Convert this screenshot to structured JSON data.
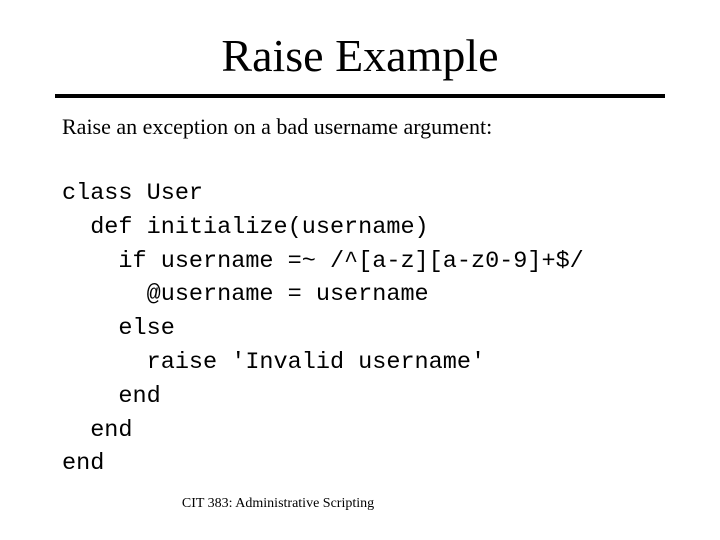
{
  "slide": {
    "title": "Raise Example",
    "intro": "Raise an exception on a bad username argument:",
    "code_lines": [
      "class User",
      "  def initialize(username)",
      "    if username =~ /^[a-z][a-z0-9]+$/",
      "      @username = username",
      "    else",
      "      raise 'Invalid username'",
      "    end",
      "  end",
      "end"
    ],
    "footer": "CIT 383: Administrative Scripting"
  }
}
